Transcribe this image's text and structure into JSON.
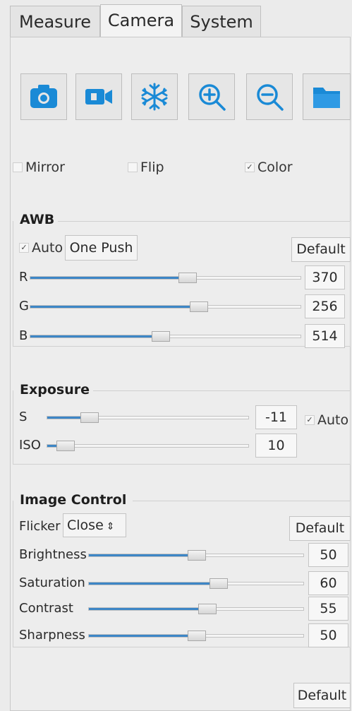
{
  "tabs": [
    {
      "label": "Measure",
      "active": false
    },
    {
      "label": "Camera",
      "active": true
    },
    {
      "label": "System",
      "active": false
    }
  ],
  "toolbar": {
    "icons": [
      "camera-icon",
      "video-icon",
      "snowflake-icon",
      "zoom-in-icon",
      "zoom-out-icon",
      "folder-icon"
    ],
    "accent": "#1a8ad6"
  },
  "options": {
    "mirror": {
      "label": "Mirror",
      "checked": false
    },
    "flip": {
      "label": "Flip",
      "checked": false
    },
    "color": {
      "label": "Color",
      "checked": true
    }
  },
  "awb": {
    "title": "AWB",
    "auto": {
      "label": "Auto",
      "checked": true
    },
    "one_push": "One Push",
    "default": "Default",
    "sliders": [
      {
        "label": "R",
        "value": "370",
        "level": 0.58
      },
      {
        "label": "G",
        "value": "256",
        "level": 0.62
      },
      {
        "label": "B",
        "value": "514",
        "level": 0.48
      }
    ]
  },
  "exposure": {
    "title": "Exposure",
    "auto": {
      "label": "Auto",
      "checked": true
    },
    "sliders": [
      {
        "label": "S",
        "value": "-11",
        "level": 0.21
      },
      {
        "label": "ISO",
        "value": "10",
        "level": 0.09
      }
    ]
  },
  "image_control": {
    "title": "Image Control",
    "flicker_label": "Flicker",
    "flicker_value": "Close",
    "default": "Default",
    "sliders": [
      {
        "label": "Brightness",
        "value": "50",
        "level": 0.5
      },
      {
        "label": "Saturation",
        "value": "60",
        "level": 0.6
      },
      {
        "label": "Contrast",
        "value": "55",
        "level": 0.55
      },
      {
        "label": "Sharpness",
        "value": "50",
        "level": 0.5
      }
    ]
  },
  "footer": {
    "default": "Default"
  }
}
